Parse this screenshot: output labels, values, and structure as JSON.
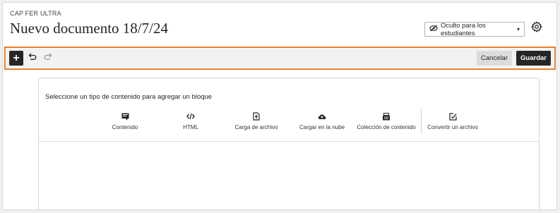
{
  "header": {
    "course_name": "CAP FER ULTRA",
    "document_title": "Nuevo documento 18/7/24",
    "visibility_label": "Oculto para los estudiantes",
    "visibility_caret": "▾"
  },
  "toolbar": {
    "add_symbol": "+",
    "cancel_label": "Cancelar",
    "save_label": "Guardar"
  },
  "content_picker": {
    "prompt": "Seleccione un tipo de contenido para agregar un bloque",
    "types": [
      {
        "label": "Contenido",
        "icon": "text-block-icon"
      },
      {
        "label": "HTML",
        "icon": "code-icon"
      },
      {
        "label": "Carga de archivo",
        "icon": "file-upload-icon"
      },
      {
        "label": "Cargar en la nube",
        "icon": "cloud-upload-icon"
      },
      {
        "label": "Colección de contenido",
        "icon": "content-collection-icon"
      },
      {
        "label": "Convertir un archivo",
        "icon": "convert-file-icon"
      }
    ]
  },
  "colors": {
    "toolbar_highlight": "#e8802e",
    "dark_button": "#262626",
    "cancel_button": "#dcdcdc"
  }
}
